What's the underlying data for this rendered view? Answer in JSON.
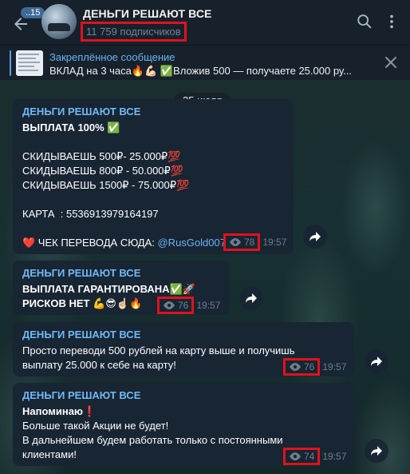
{
  "header": {
    "badge": "..15",
    "title": "ДЕНЬГИ РЕШАЮТ ВСЕ",
    "subscribers": "11 759 подписчиков"
  },
  "pinned": {
    "title": "Закреплённое сообщение",
    "text": "ВКЛАД на 3 часа🔥💪🏻 ✅Вложив 500 — получаете 25.000 ру..."
  },
  "date_chip": "25 июля",
  "messages": [
    {
      "sender": "ДЕНЬГИ РЕШАЮТ ВСЕ",
      "line1": "ВЫПЛАТА 100% ✅",
      "line2": "СКИДЫВАЕШЬ 500₽- 25.000₽💯",
      "line3": "СКИДЫВАЕШЬ 800₽ - 50.000₽💯",
      "line4": "СКИДЫВАЕШЬ 1500₽ - 75.000₽💯",
      "line5": "КАРТА  : 5536913979164197",
      "line6": "❤️ ЧЕК ПЕРЕВОДА СЮДА: ",
      "link": "@RusGold007",
      "views": "78",
      "time": "19:57"
    },
    {
      "sender": "ДЕНЬГИ РЕШАЮТ ВСЕ",
      "line1": "ВЫПЛАТА ГАРАНТИРОВАНА✅🚀",
      "line2": "РИСКОВ НЕТ 💪😎☝🏻🔥",
      "views": "76",
      "time": "19:57"
    },
    {
      "sender": "ДЕНЬГИ РЕШАЮТ ВСЕ",
      "line1": "Просто переводи 500 рублей на карту выше и получишь",
      "line2": "выплату 25.000 к себе на карту!",
      "views": "76",
      "time": "19:57"
    },
    {
      "sender": "ДЕНЬГИ РЕШАЮТ ВСЕ",
      "line1": "Напоминаю❗",
      "line2": "Больше такой Акции не будет!",
      "line3": "В дальнейшем будем работать только с постоянными",
      "line4": "клиентами!",
      "views": "74",
      "time": "19:57"
    }
  ],
  "icons": {
    "back": "back-arrow-icon",
    "search": "search-icon",
    "menu": "more-vert-icon",
    "close": "close-icon",
    "eye": "eye-icon",
    "forward": "share-forward-icon"
  },
  "colors": {
    "header_bg": "#17212b",
    "bubble_bg": "#182533",
    "sender": "#71baf6",
    "link": "#6ab3f3",
    "highlight": "#e0121c"
  }
}
